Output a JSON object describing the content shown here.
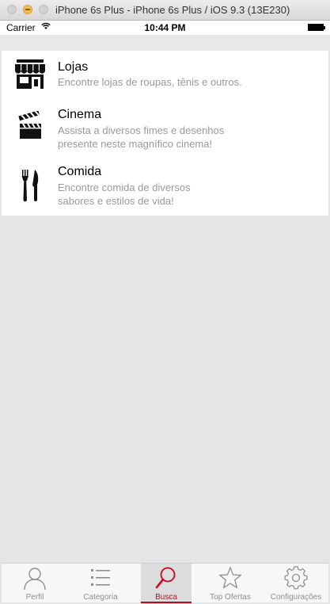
{
  "window": {
    "title": "iPhone 6s Plus - iPhone 6s Plus / iOS 9.3 (13E230)"
  },
  "status_bar": {
    "carrier": "Carrier",
    "time": "10:44 PM"
  },
  "list": {
    "items": [
      {
        "icon": "store-icon",
        "title": "Lojas",
        "subtitle": "Encontre lojas de roupas, tênis e outros."
      },
      {
        "icon": "clapperboard-icon",
        "title": "Cinema",
        "subtitle": "Assista a diversos fimes e desenhos presente neste magnífico cinema!"
      },
      {
        "icon": "fork-knife-icon",
        "title": "Comida",
        "subtitle": "Encontre comida de diversos sabores e estilos de vida!"
      }
    ]
  },
  "tab_bar": {
    "accent_color": "#d0021b",
    "selected": "Busca",
    "tabs": [
      {
        "icon": "person-icon",
        "label": "Perfil"
      },
      {
        "icon": "list-icon",
        "label": "Categoria"
      },
      {
        "icon": "search-icon",
        "label": "Busca"
      },
      {
        "icon": "star-icon",
        "label": "Top Ofertas"
      },
      {
        "icon": "gear-icon",
        "label": "Configurações"
      }
    ]
  }
}
